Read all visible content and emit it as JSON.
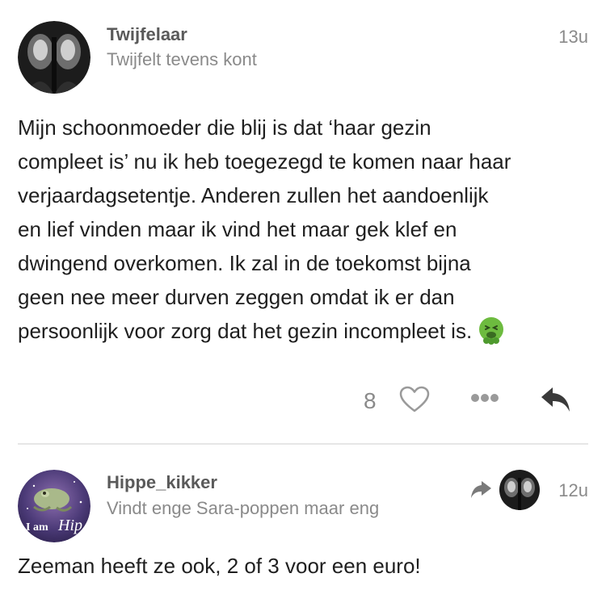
{
  "posts": [
    {
      "author": "Twijfelaar",
      "title": "Twijfelt tevens kont",
      "time": "13u",
      "lines": [
        "Mijn schoonmoeder die blij is dat ‘haar gezin",
        "compleet is’ nu ik heb toegezegd te komen naar haar",
        "verjaardagsetentje. Anderen zullen het aandoenlijk",
        "en lief vinden maar ik vind het maar gek klef en",
        "dwingend overkomen. Ik zal in de toekomst bijna",
        "geen nee meer durven zeggen omdat ik er dan",
        "persoonlijk voor zorg dat het gezin incompleet is."
      ],
      "emoji": "nauseated-face-emoji",
      "likes": "8"
    },
    {
      "author": "Hippe_kikker",
      "title": "Vindt enge Sara-poppen maar eng",
      "time": "12u",
      "avatar_text": "I am Hip",
      "body": "Zeeman heeft ze ook, 2 of 3 voor een euro!"
    }
  ],
  "icons": {
    "like": "heart-icon",
    "more": "more-dots-icon",
    "reply": "reply-arrow-icon",
    "reply_to": "reply-to-arrow-icon"
  },
  "colors": {
    "text": "#1f1f1f",
    "muted": "#8a8a8a",
    "username": "#5a5a5a",
    "divider": "#e6e6e6",
    "emoji_green": "#6dbb3f"
  }
}
